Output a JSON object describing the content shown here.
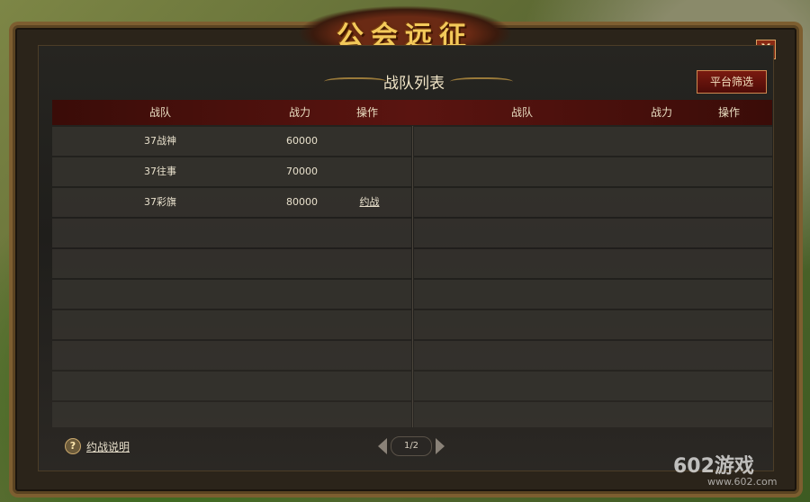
{
  "window": {
    "title": "公会远征",
    "subtitle": "战队列表",
    "close_label": "X",
    "filter_button": "平台筛选"
  },
  "table": {
    "left_headers": [
      "战队",
      "战力",
      "操作"
    ],
    "right_headers": [
      "战队",
      "战力",
      "操作"
    ],
    "left_rows": [
      {
        "team": "37战神",
        "power": "60000",
        "action": ""
      },
      {
        "team": "37往事",
        "power": "70000",
        "action": ""
      },
      {
        "team": "37彩旗",
        "power": "80000",
        "action": "约战"
      }
    ]
  },
  "footer": {
    "help_icon": "?",
    "help_label": "约战说明",
    "page_indicator": "1/2"
  },
  "watermark": {
    "brand": "602游戏",
    "url": "www.602.com"
  },
  "colors": {
    "title_gold": "#f3c95a",
    "header_red": "#5a1410",
    "button_red": "#7a1a10"
  }
}
